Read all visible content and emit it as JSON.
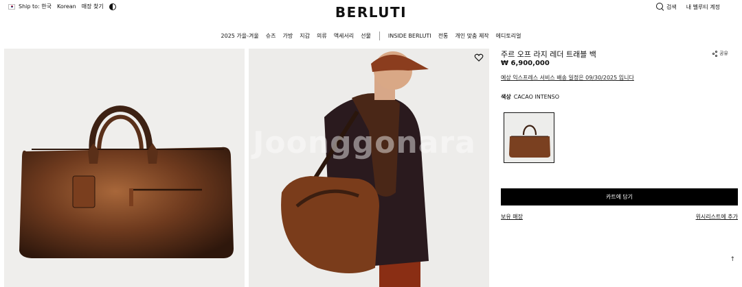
{
  "header": {
    "ship_to": "Ship to: 한국",
    "language": "Korean",
    "store_finder": "매장 찾기",
    "logo": "BERLUTI",
    "search_label": "검색",
    "beauty_account": "내 벨루티 계정"
  },
  "nav": {
    "items_left": [
      "2025 가을-겨울",
      "슈즈",
      "가방",
      "지갑",
      "의류",
      "액세서리",
      "선물"
    ],
    "items_right": [
      "INSIDE BERLUTI",
      "전통",
      "개인 맞춤 제작",
      "에디토리얼"
    ]
  },
  "watermark": "Joonggonara",
  "product": {
    "title": "주르 오프 라지 레더 트래블 백",
    "price": "₩ 6,900,000",
    "delivery": "예상 익스프레스 서비스 배송 일정은 09/30/2025 입니다",
    "color_label": "색상",
    "color_value": "CACAO INTENSO",
    "share": "공유",
    "add_to_cart": "카트에 담기",
    "store_stock": "보유 매장",
    "add_wishlist": "위시리스트에 추가",
    "scroll_top": "↑"
  },
  "colors": {
    "leather_dark": "#3a1f12",
    "leather_mid": "#6e3a1e",
    "leather_light": "#a8673a",
    "button_bg": "#000000"
  }
}
